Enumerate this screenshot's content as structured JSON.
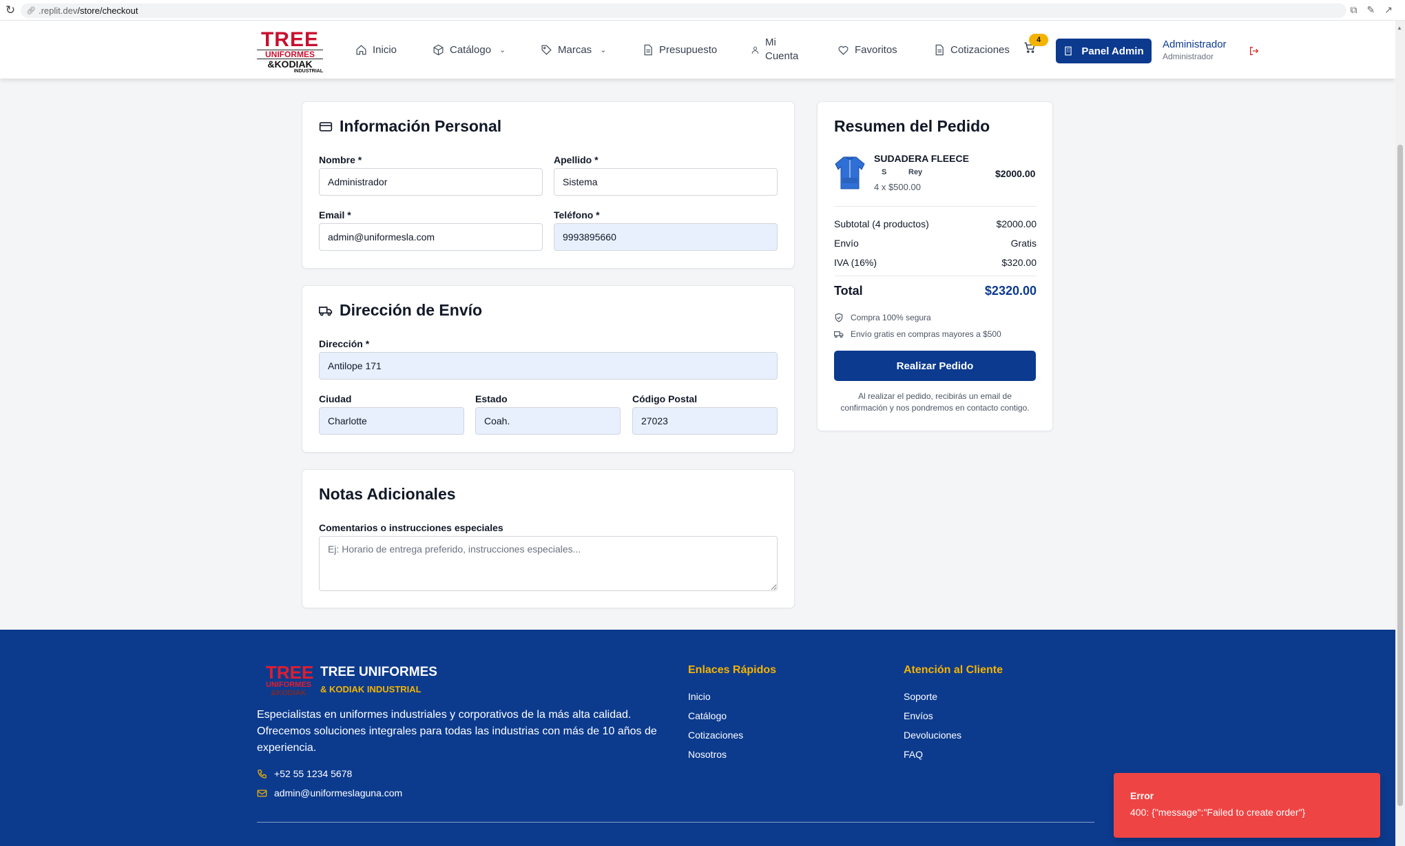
{
  "browser": {
    "url_host": ".replit.dev",
    "url_path": "/store/checkout",
    "icons": [
      "reload-icon",
      "translate-icon",
      "edit-icon",
      "open-external-icon"
    ]
  },
  "header": {
    "logo": {
      "line1": "TREE",
      "line2": "UNIFORMES",
      "line3": "&KODIAK",
      "line4": "INDUSTRIAL"
    },
    "nav": [
      {
        "label": "Inicio",
        "icon": "home-icon"
      },
      {
        "label": "Catálogo",
        "icon": "box-icon"
      },
      {
        "label": "Marcas",
        "icon": "tag-icon"
      },
      {
        "label": "Presupuesto",
        "icon": "file-icon"
      },
      {
        "label_line1": "Mi",
        "label_line2": "Cuenta",
        "icon": "user-icon"
      },
      {
        "label": "Favoritos",
        "icon": "heart-icon"
      },
      {
        "label": "Cotizaciones",
        "icon": "document-icon"
      }
    ],
    "cart_count": "4",
    "panel_admin_label": "Panel Admin",
    "user_name": "Administrador",
    "user_role": "Administrador"
  },
  "personal": {
    "title": "Información Personal",
    "nombre_label": "Nombre *",
    "nombre_value": "Administrador",
    "apellido_label": "Apellido *",
    "apellido_value": "Sistema",
    "email_label": "Email *",
    "email_value": "admin@uniformesla.com",
    "telefono_label": "Teléfono *",
    "telefono_value": "9993895660"
  },
  "shipping": {
    "title": "Dirección de Envío",
    "direccion_label": "Dirección *",
    "direccion_value": "Antilope 171",
    "ciudad_label": "Ciudad",
    "ciudad_value": "Charlotte",
    "estado_label": "Estado",
    "estado_value": "Coah.",
    "cp_label": "Código Postal",
    "cp_value": "27023"
  },
  "notes": {
    "title": "Notas Adicionales",
    "label": "Comentarios o instrucciones especiales",
    "placeholder": "Ej: Horario de entrega preferido, instrucciones especiales..."
  },
  "summary": {
    "title": "Resumen del Pedido",
    "product_name": "SUDADERA FLEECE",
    "product_size": "S",
    "product_color": "Rey",
    "product_qty": "4 x $500.00",
    "product_total": "$2000.00",
    "subtotal_label": "Subtotal (4 productos)",
    "subtotal_value": "$2000.00",
    "envio_label": "Envío",
    "envio_value": "Gratis",
    "iva_label": "IVA (16%)",
    "iva_value": "$320.00",
    "total_label": "Total",
    "total_value": "$2320.00",
    "secure_note": "Compra 100% segura",
    "shipping_note": "Envío gratis en compras mayores a $500",
    "button_label": "Realizar Pedido",
    "footer_note": "Al realizar el pedido, recibirás un email de confirmación y nos pondremos en contacto contigo.",
    "accent_color": "#0b3a8f"
  },
  "footer": {
    "logo": {
      "line1": "TREE",
      "line2": "UNIFORMES",
      "line3": "&KODIAK"
    },
    "brand": "TREE UNIFORMES",
    "sub": "& KODIAK INDUSTRIAL",
    "description": "Especialistas en uniformes industriales y corporativos de la más alta calidad. Ofrecemos soluciones integrales para todas las industrias con más de 10 años de experiencia.",
    "phone": "+52 55 1234 5678",
    "email": "admin@uniformeslaguna.com",
    "quick_links_title": "Enlaces Rápidos",
    "quick_links": [
      "Inicio",
      "Catálogo",
      "Cotizaciones",
      "Nosotros"
    ],
    "support_title": "Atención al Cliente",
    "support_links": [
      "Soporte",
      "Envíos",
      "Devoluciones",
      "FAQ"
    ],
    "bg_color": "#0c3b8e",
    "accent_color": "#f5b301"
  },
  "toast": {
    "title": "Error",
    "message": "400: {\"message\":\"Failed to create order\"}",
    "color": "#ef4444"
  }
}
